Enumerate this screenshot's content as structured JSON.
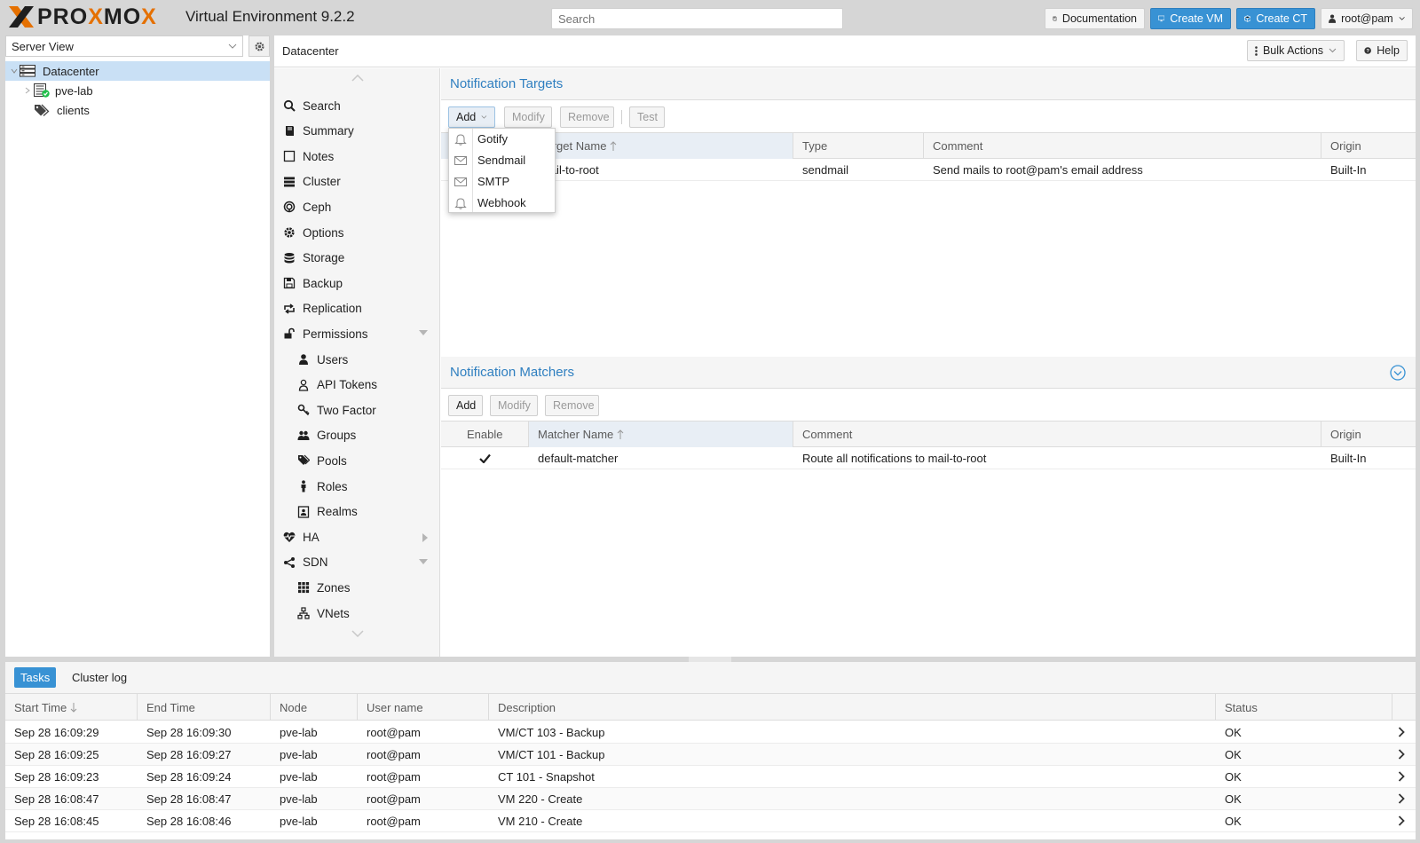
{
  "header": {
    "product_title": "Virtual Environment 9.2.2",
    "search_placeholder": "Search",
    "documentation_label": "Documentation",
    "create_vm_label": "Create VM",
    "create_ct_label": "Create CT",
    "user_label": "root@pam"
  },
  "resource_tree": {
    "view_selector": "Server View",
    "nodes": [
      {
        "label": "Datacenter",
        "icon": "datacenter-icon",
        "selected": true
      },
      {
        "label": "pve-lab",
        "icon": "node-online-icon"
      },
      {
        "label": "clients",
        "icon": "tags-icon"
      }
    ]
  },
  "center": {
    "breadcrumb": "Datacenter",
    "bulk_actions_label": "Bulk Actions",
    "help_label": "Help"
  },
  "nav": {
    "items": [
      {
        "label": "Search",
        "icon": "search-icon"
      },
      {
        "label": "Summary",
        "icon": "book-icon"
      },
      {
        "label": "Notes",
        "icon": "notes-icon"
      },
      {
        "label": "Cluster",
        "icon": "cluster-icon"
      },
      {
        "label": "Ceph",
        "icon": "ceph-icon"
      },
      {
        "label": "Options",
        "icon": "gear-icon"
      },
      {
        "label": "Storage",
        "icon": "database-icon"
      },
      {
        "label": "Backup",
        "icon": "floppy-icon"
      },
      {
        "label": "Replication",
        "icon": "retweet-icon"
      },
      {
        "label": "Permissions",
        "icon": "unlock-icon",
        "expandable": "down"
      },
      {
        "label": "Users",
        "icon": "user-icon",
        "indent": true
      },
      {
        "label": "API Tokens",
        "icon": "user-outline-icon",
        "indent": true
      },
      {
        "label": "Two Factor",
        "icon": "key-icon",
        "indent": true
      },
      {
        "label": "Groups",
        "icon": "users-icon",
        "indent": true
      },
      {
        "label": "Pools",
        "icon": "tags-icon",
        "indent": true
      },
      {
        "label": "Roles",
        "icon": "male-icon",
        "indent": true
      },
      {
        "label": "Realms",
        "icon": "address-book-icon",
        "indent": true
      },
      {
        "label": "HA",
        "icon": "heartbeat-icon",
        "expandable": "right"
      },
      {
        "label": "SDN",
        "icon": "sdn-icon",
        "expandable": "down"
      },
      {
        "label": "Zones",
        "icon": "zones-icon",
        "indent": true
      },
      {
        "label": "VNets",
        "icon": "vnets-icon",
        "indent": true
      }
    ]
  },
  "targets_panel": {
    "title": "Notification Targets",
    "buttons": {
      "add": "Add",
      "modify": "Modify",
      "remove": "Remove",
      "test": "Test"
    },
    "columns": [
      "Target Name",
      "Type",
      "Comment",
      "Origin"
    ],
    "rows": [
      {
        "name": "mail-to-root",
        "type": "sendmail",
        "comment": "Send mails to root@pam's email address",
        "origin": "Built-In"
      }
    ],
    "add_menu": [
      {
        "label": "Gotify",
        "icon": "bell-icon"
      },
      {
        "label": "Sendmail",
        "icon": "envelope-icon"
      },
      {
        "label": "SMTP",
        "icon": "envelope-icon"
      },
      {
        "label": "Webhook",
        "icon": "bell-icon"
      }
    ]
  },
  "matchers_panel": {
    "title": "Notification Matchers",
    "buttons": {
      "add": "Add",
      "modify": "Modify",
      "remove": "Remove"
    },
    "columns": [
      "Enable",
      "Matcher Name",
      "Comment",
      "Origin"
    ],
    "rows": [
      {
        "enabled": true,
        "name": "default-matcher",
        "comment": "Route all notifications to mail-to-root",
        "origin": "Built-In"
      }
    ]
  },
  "bottom": {
    "tabs": [
      "Tasks",
      "Cluster log"
    ],
    "columns": [
      "Start Time",
      "End Time",
      "Node",
      "User name",
      "Description",
      "Status"
    ],
    "rows": [
      {
        "start": "Sep 28 16:09:29",
        "end": "Sep 28 16:09:30",
        "node": "pve-lab",
        "user": "root@pam",
        "desc": "VM/CT 103 - Backup",
        "status": "OK"
      },
      {
        "start": "Sep 28 16:09:25",
        "end": "Sep 28 16:09:27",
        "node": "pve-lab",
        "user": "root@pam",
        "desc": "VM/CT 101 - Backup",
        "status": "OK"
      },
      {
        "start": "Sep 28 16:09:23",
        "end": "Sep 28 16:09:24",
        "node": "pve-lab",
        "user": "root@pam",
        "desc": "CT 101 - Snapshot",
        "status": "OK"
      },
      {
        "start": "Sep 28 16:08:47",
        "end": "Sep 28 16:08:47",
        "node": "pve-lab",
        "user": "root@pam",
        "desc": "VM 220 - Create",
        "status": "OK"
      },
      {
        "start": "Sep 28 16:08:45",
        "end": "Sep 28 16:08:46",
        "node": "pve-lab",
        "user": "root@pam",
        "desc": "VM 210 - Create",
        "status": "OK"
      }
    ]
  },
  "colors": {
    "accent": "#3892d4",
    "panel_title": "#2f7fc0",
    "brand_orange": "#e57000",
    "selection": "#c9e0f5"
  }
}
